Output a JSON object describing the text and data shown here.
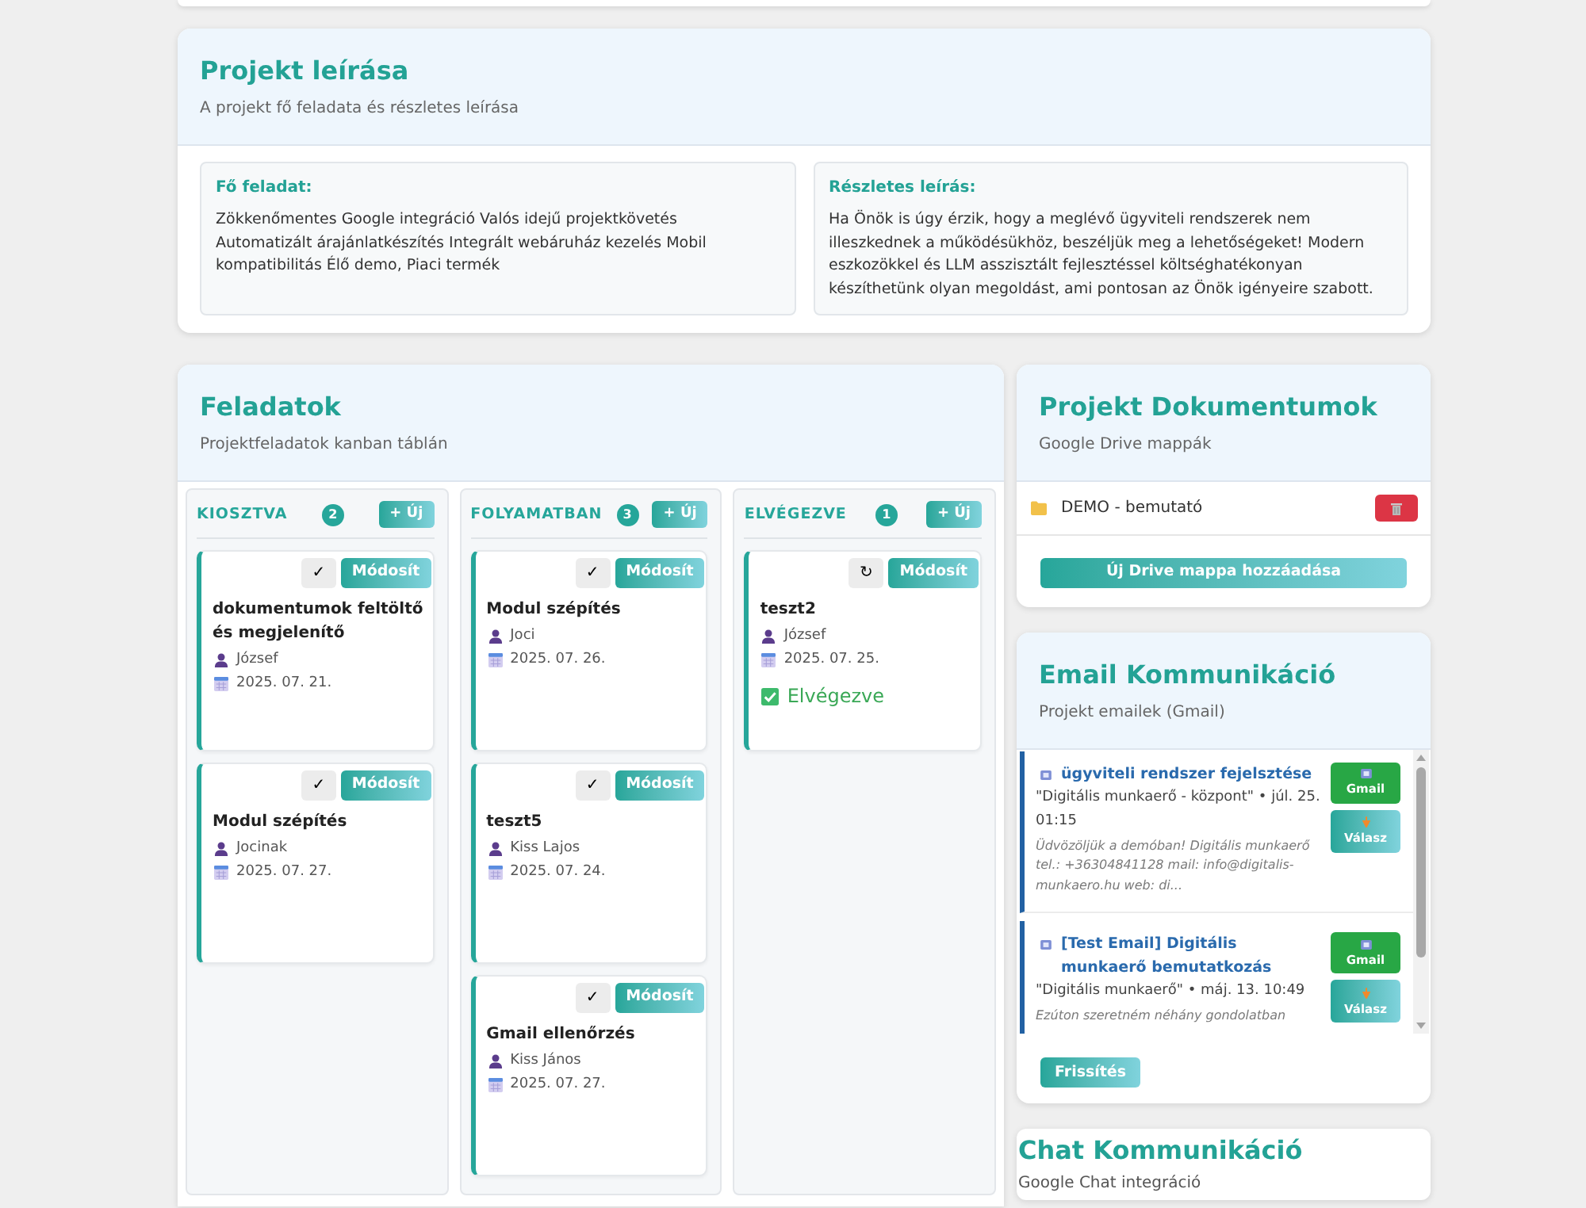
{
  "description": {
    "title": "Projekt leírása",
    "subtitle": "A projekt fő feladata és részletes leírása",
    "sections": [
      {
        "label": "Fő feladat:",
        "text": "Zökkenőmentes Google integráció Valós idejű projektkövetés Automatizált árajánlatkészítés Integrált webáruház kezelés Mobil kompatibilitás Élő demo, Piaci termék"
      },
      {
        "label": "Részletes leírás:",
        "text": "Ha Önök is úgy érzik, hogy a meglévő ügyviteli rendszerek nem illeszkednek a működésükhöz, beszéljük meg a lehetőségeket! Modern eszkozökkel és LLM asszisztált fejlesztéssel költséghatékonyan készíthetünk olyan megoldást, ami pontosan az Önök igényeire szabott."
      }
    ]
  },
  "tasks": {
    "title": "Feladatok",
    "subtitle": "Projektfeladatok kanban táblán",
    "columns": [
      {
        "title": "KIOSZTVA",
        "count": "2",
        "add_button": "+ Új",
        "cards": [
          {
            "title": "dokumentumok feltöltő és megjelenítő",
            "assignee": "József",
            "due": "2025. 07. 21.",
            "toggle_button": "✓",
            "edit_button": "Módosít"
          },
          {
            "title": "Modul szépítés",
            "assignee": "Jocinak",
            "due": "2025. 07. 27.",
            "toggle_button": "✓",
            "edit_button": "Módosít"
          }
        ]
      },
      {
        "title": "FOLYAMATBAN",
        "count": "3",
        "add_button": "+ Új",
        "cards": [
          {
            "title": "Modul szépítés",
            "assignee": "Joci",
            "due": "2025. 07. 26.",
            "toggle_button": "✓",
            "edit_button": "Módosít"
          },
          {
            "title": "teszt5",
            "assignee": "Kiss Lajos",
            "due": "2025. 07. 24.",
            "toggle_button": "✓",
            "edit_button": "Módosít"
          },
          {
            "title": "Gmail ellenőrzés",
            "assignee": "Kiss János",
            "due": "2025. 07. 27.",
            "toggle_button": "✓",
            "edit_button": "Módosít"
          }
        ]
      },
      {
        "title": "ELVÉGEZVE",
        "count": "1",
        "add_button": "+ Új",
        "cards": [
          {
            "title": "teszt2",
            "assignee": "József",
            "due": "2025. 07. 25.",
            "toggle_button": "↻",
            "edit_button": "Módosít",
            "status": "Elvégezve"
          }
        ]
      }
    ]
  },
  "documents": {
    "title": "Projekt Dokumentumok",
    "subtitle": "Google Drive mappák",
    "folders": [
      {
        "name": "DEMO - bemutató"
      }
    ],
    "add_button": "Új Drive mappa hozzáadása"
  },
  "email": {
    "title": "Email Kommunikáció",
    "subtitle": "Projekt emailek (Gmail)",
    "messages": [
      {
        "subject": "ügyviteli rendszer fejelsztése",
        "meta": "\"Digitális munkaerő - központ\" • júl. 25. 01:15",
        "snippet": "Üdvözöljük a demóban! Digitális munkaerő tel.: +36304841128 mail: info@digitalis-munkaero.hu web: di...",
        "gmail_button": "Gmail",
        "reply_button": "Válasz"
      },
      {
        "subject": "[Test Email] Digitális munkaerő bemutatkozás",
        "meta": "\"Digitális munkaerő\" • máj. 13. 10:49",
        "snippet": "Ezúton szeretném néhány gondolatban",
        "gmail_button": "Gmail",
        "reply_button": "Válasz"
      }
    ],
    "refresh_button": "Frissítés"
  },
  "chat": {
    "title": "Chat Kommunikáció",
    "subtitle": "Google Chat integráció"
  }
}
